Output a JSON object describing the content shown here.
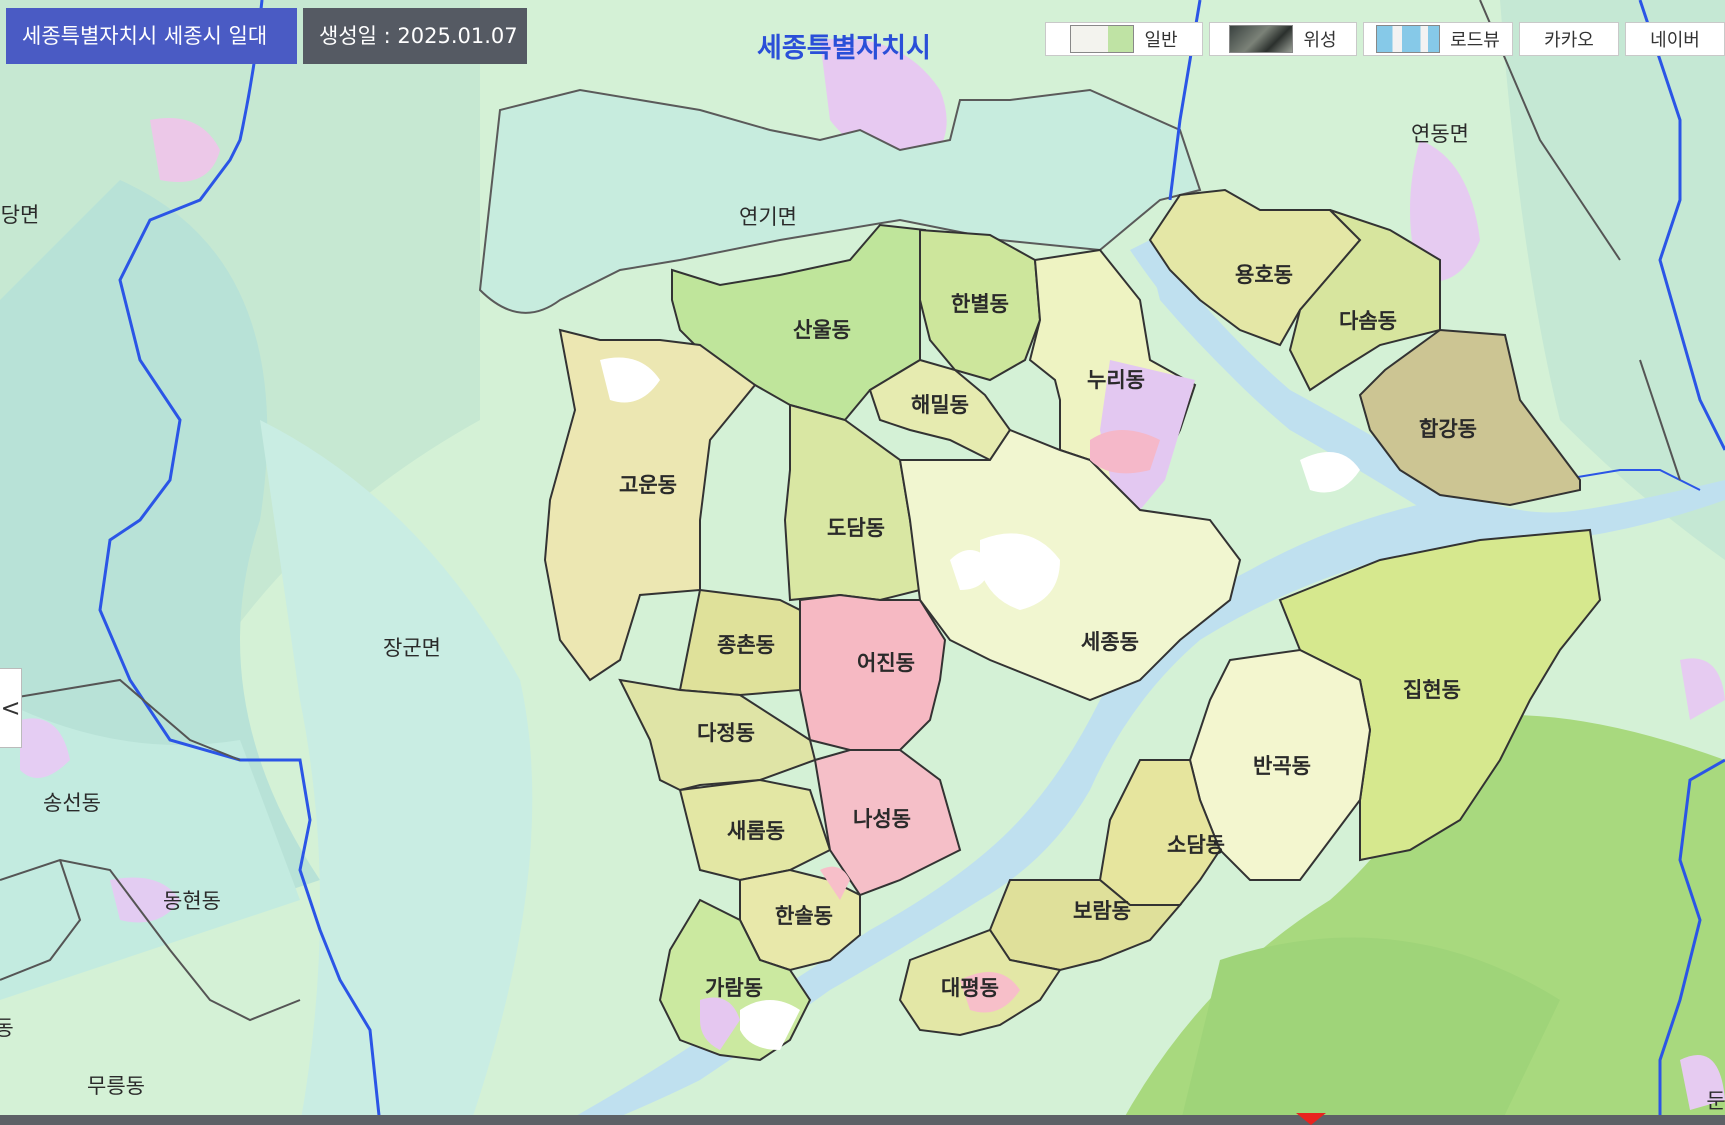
{
  "header": {
    "region": "세종특별자치시 세종시 일대",
    "generated": "생성일 : 2025.01.07"
  },
  "switcher": {
    "normal": "일반",
    "satellite": "위성",
    "roadview": "로드뷰",
    "kakao": "카카오",
    "naver": "네이버"
  },
  "side_toggle": "<",
  "map": {
    "city_label": "세종특별자치시",
    "places": {
      "yeongi": "연기면",
      "yeondong": "연동면",
      "janggun": "장군면",
      "dangmyeon": "당면",
      "songseon": "송선동",
      "donghyeon": "동현동",
      "mureung": "무릉동",
      "dong_edge_left": "동",
      "dun_edge_right": "둔"
    },
    "districts": {
      "sanul": "산울동",
      "hanbyeol": "한별동",
      "nuri": "누리동",
      "yongho": "용호동",
      "dasom": "다솜동",
      "haemil": "해밀동",
      "hapgang": "합강동",
      "goun": "고운동",
      "dodam": "도담동",
      "jongchon": "종촌동",
      "eojin": "어진동",
      "sejong": "세종동",
      "dajeong": "다정동",
      "jiphyeon": "집현동",
      "bangok": "반곡동",
      "saerom": "새롬동",
      "naseong": "나성동",
      "sodam": "소담동",
      "boram": "보람동",
      "hansol": "한솔동",
      "garam": "가람동",
      "daepyeong": "대평동"
    }
  },
  "colors": {
    "region_tag": "#4a5bc4",
    "date_tag": "#555a63",
    "river": "#bfe0ef",
    "boundary": "#2b55e6",
    "district_border": "#333333",
    "city_label": "#2a4fd8",
    "commercial": "#f6b9c3",
    "residential": "#e9e3a0",
    "industrial": "#e6c6f0"
  }
}
